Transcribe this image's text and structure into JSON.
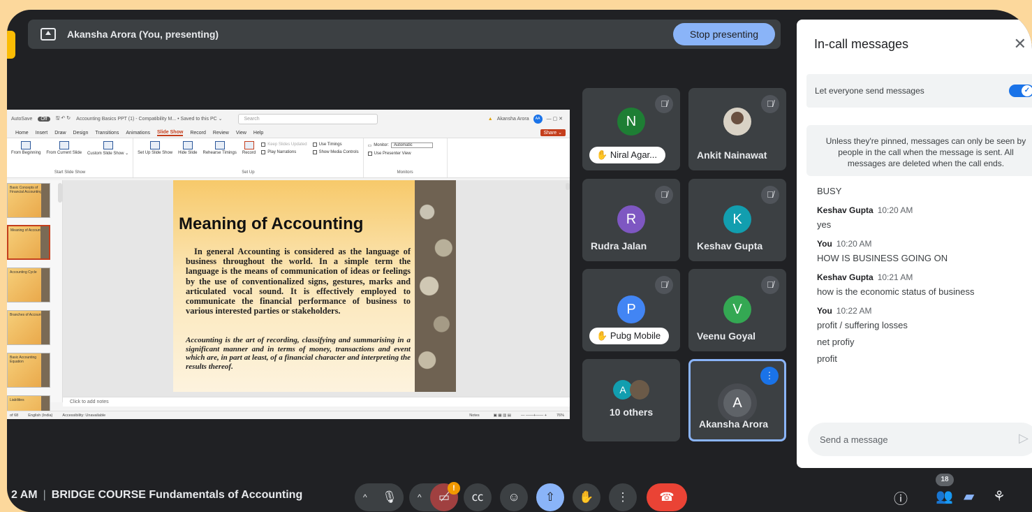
{
  "presenting_bar": {
    "title": "Akansha Arora (You, presenting)",
    "stop_label": "Stop presenting"
  },
  "ppt": {
    "autosave": "AutoSave",
    "autosave_state": "Off",
    "filename": "Accounting Basics PPT (1) - Compatibility M... • Saved to this PC ⌄",
    "search_placeholder": "Search",
    "user": "Akansha Arora",
    "user_initials": "AA",
    "menu": [
      "Home",
      "Insert",
      "Draw",
      "Design",
      "Transitions",
      "Animations",
      "Slide Show",
      "Record",
      "Review",
      "View",
      "Help"
    ],
    "active_menu": "Slide Show",
    "share_label": "Share ⌄",
    "ribbon": {
      "start_group": "Start Slide Show",
      "setup_group": "Set Up",
      "monitors_group": "Monitors",
      "buttons": [
        "From Beginning",
        "From Current Slide",
        "Custom Slide Show ⌄",
        "Set Up Slide Show",
        "Hide Slide",
        "Rehearse Timings",
        "Record"
      ],
      "keep_slides": "Keep Slides Updated",
      "use_timings": "Use Timings",
      "play_narrations": "Play Narrations",
      "show_media": "Show Media Controls",
      "monitor_label": "Monitor:",
      "monitor_value": "Automatic",
      "presenter_view": "Use Presenter View"
    },
    "thumbs": [
      "Basic Concepts of Financial Accounting",
      "Meaning of Accounting",
      "Accounting Cycle",
      "Branches of Accounting",
      "Basic Accounting Equation",
      "Liabilities"
    ],
    "slide": {
      "title": "Meaning of Accounting",
      "body": "In general Accounting is considered as the language of business throughout the world. In a simple term the language is the means of communication of ideas or feelings by the use of conventionalized signs, gestures, marks and articulated vocal sound. It is effectively employed to communicate the financial performance of business to various interested parties or stakeholders.",
      "italic": "Accounting is the art of recording, classifying and summarising in a significant manner and in terms of money, transactions and event which are, in part at least, of a financial character and interpreting the results thereof."
    },
    "notes_placeholder": "Click to add notes",
    "status": {
      "slide": "of 68",
      "lang": "English (India)",
      "access": "Accessibility: Unavailable",
      "notes": "Notes",
      "zoom": "76%"
    }
  },
  "tiles": [
    {
      "name": "Niral Agar...",
      "initial": "N",
      "color": "#1e7e34",
      "pill": true
    },
    {
      "name": "Ankit Nainawat",
      "initial": "",
      "color": "#e8e8e8",
      "pill": false
    },
    {
      "name": "Rudra Jalan",
      "initial": "R",
      "color": "#7e57c2",
      "pill": false
    },
    {
      "name": "Keshav Gupta",
      "initial": "K",
      "color": "#129eaf",
      "pill": false
    },
    {
      "name": "Pubg Mobile",
      "initial": "P",
      "color": "#4285f4",
      "pill": true
    },
    {
      "name": "Veenu Goyal",
      "initial": "V",
      "color": "#34a853",
      "pill": false
    },
    {
      "name": "10 others",
      "initial": "A",
      "color": "#129eaf",
      "pill": false
    },
    {
      "name": "Akansha Arora",
      "initial": "A",
      "color": "#5f6368",
      "pill": false
    }
  ],
  "chat": {
    "title": "In-call messages",
    "let_everyone": "Let everyone send messages",
    "info": "Unless they're pinned, messages can only be seen by people in the call when the message is sent. All messages are deleted when the call ends.",
    "first_msg": "BUSY",
    "messages": [
      {
        "sender": "Keshav Gupta",
        "time": "10:20 AM",
        "lines": [
          "yes"
        ]
      },
      {
        "sender": "You",
        "time": "10:20 AM",
        "lines": [
          "HOW IS BUSINESS GOING ON"
        ]
      },
      {
        "sender": "Keshav Gupta",
        "time": "10:21 AM",
        "lines": [
          "how is the economic status of business"
        ]
      },
      {
        "sender": "You",
        "time": "10:22 AM",
        "lines": [
          "profit / suffering losses",
          "net profiy",
          "profit"
        ]
      }
    ],
    "send_placeholder": "Send a message"
  },
  "bottom": {
    "time": "2 AM",
    "meeting": "BRIDGE COURSE Fundamentals of Accounting",
    "people_count": "18",
    "cam_warning": "!"
  }
}
